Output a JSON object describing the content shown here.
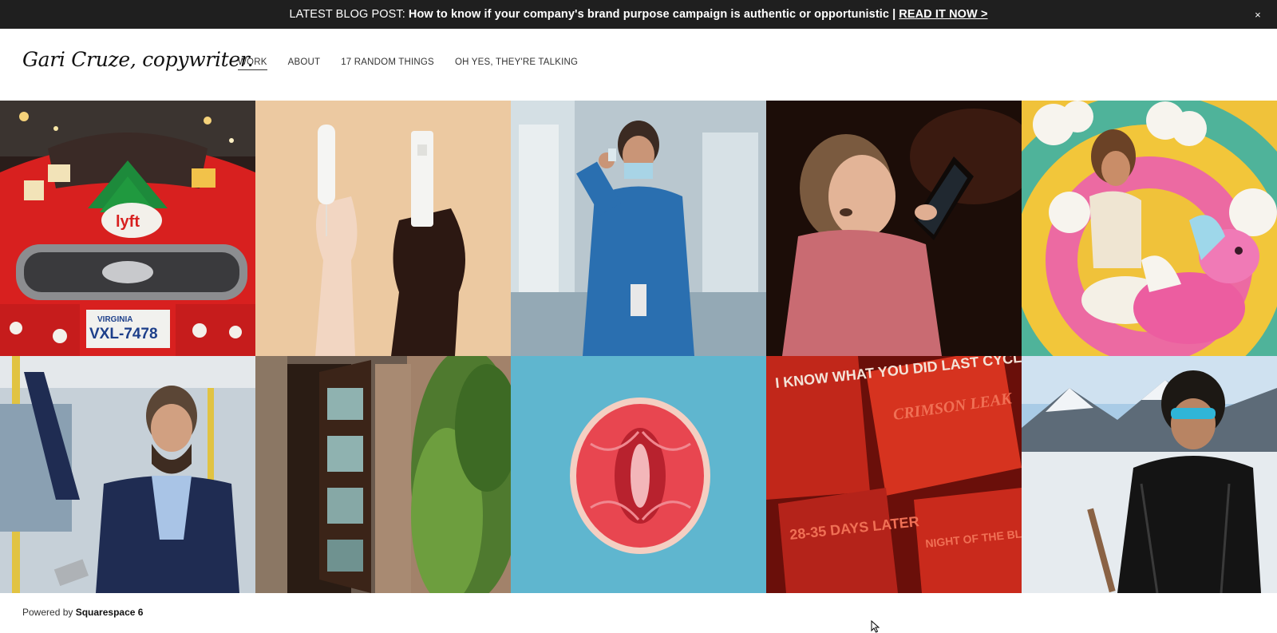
{
  "announcement": {
    "lead": "LATEST BLOG POST:",
    "headline": "How to know if your company's brand purpose campaign is authentic or opportunistic",
    "separator": "|",
    "cta": "READ IT NOW >",
    "close_icon": "close-icon",
    "close_glyph": "×"
  },
  "site": {
    "logo": "Gari Cruze, copywriter."
  },
  "nav": {
    "items": [
      {
        "label": "WORK",
        "active": true
      },
      {
        "label": "ABOUT",
        "active": false
      },
      {
        "label": "17 RANDOM THINGS",
        "active": false
      },
      {
        "label": "OH YES, THEY'RE TALKING",
        "active": false
      }
    ]
  },
  "gallery": {
    "tiles": [
      {
        "subject": "red knitted car with Lyft logo and Christmas tree"
      },
      {
        "subject": "two hands holding tampons on tan background"
      },
      {
        "subject": "nurse in blue scrubs holding vial"
      },
      {
        "subject": "young girl looking at tablet in dark"
      },
      {
        "subject": "woman riding pink unicorn toy in front of rainbow"
      },
      {
        "subject": "bearded man on train looking at phone"
      },
      {
        "subject": "open dark wood glass door with bamboo"
      },
      {
        "subject": "grapefruit half on blue background"
      },
      {
        "subject": "red horror style movie posters"
      },
      {
        "subject": "man in sunglasses with snowy mountains"
      }
    ],
    "poster_texts": [
      "I KNOW WHAT YOU DID LAST CYCLE",
      "CRIMSON LEAK",
      "28-35 DAYS LATER",
      "NIGHT OF THE BLOODY BED"
    ],
    "license_plate": {
      "state": "VIRGINIA",
      "number": "VXL-7478"
    },
    "car_logo": "lyft"
  },
  "footer": {
    "prefix": "Powered by",
    "brand": "Squarespace 6"
  },
  "colors": {
    "announce_bg": "#1f1f1f",
    "page_bg": "#ffffff",
    "text": "#222222"
  }
}
